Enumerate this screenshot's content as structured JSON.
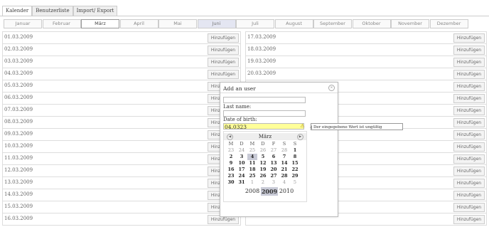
{
  "tabs": [
    "Kalender",
    "Benutzerliste",
    "Import/ Export"
  ],
  "months": [
    "Januar",
    "Februar",
    "März",
    "April",
    "Mai",
    "Juni",
    "Juli",
    "August",
    "September",
    "Oktober",
    "November",
    "Dezember"
  ],
  "selected_month": "Juni",
  "left_dates": [
    "01.03.2009",
    "02.03.2009",
    "03.03.2009",
    "04.03.2009",
    "05.03.2009",
    "06.03.2009",
    "07.03.2009",
    "08.03.2009",
    "09.03.2009",
    "10.03.2009",
    "11.03.2009",
    "12.03.2009",
    "13.03.2009",
    "14.03.2009",
    "15.03.2009",
    "16.03.2009"
  ],
  "right_dates": [
    "17.03.2009",
    "18.03.2009",
    "19.03.2009",
    "20.03.2009",
    "",
    "",
    "",
    "",
    "",
    "",
    "",
    "",
    "",
    "",
    "",
    ""
  ],
  "add_label": "Hinzufügen",
  "dialog": {
    "title": "Add an user",
    "last_name_label": "Last name:",
    "dob_label": "Date of birth:",
    "dob_value": "04.0323",
    "tooltip": "Der eingegebene Wert ist ungültig",
    "calendar": {
      "month": "März",
      "weekdays": [
        "M",
        "D",
        "M",
        "D",
        "F",
        "S",
        "S"
      ],
      "weeks": [
        [
          "23",
          "24",
          "25",
          "26",
          "27",
          "28",
          "1"
        ],
        [
          "2",
          "3",
          "4",
          "5",
          "6",
          "7",
          "8"
        ],
        [
          "9",
          "10",
          "11",
          "12",
          "13",
          "14",
          "15"
        ],
        [
          "16",
          "17",
          "18",
          "19",
          "20",
          "21",
          "22"
        ],
        [
          "23",
          "24",
          "25",
          "26",
          "27",
          "28",
          "29"
        ],
        [
          "30",
          "31",
          "1",
          "2",
          "3",
          "4",
          "5"
        ]
      ],
      "years": [
        "2008",
        "2009",
        "2010"
      ],
      "selected_year": "2009",
      "selected_day": "4"
    }
  }
}
